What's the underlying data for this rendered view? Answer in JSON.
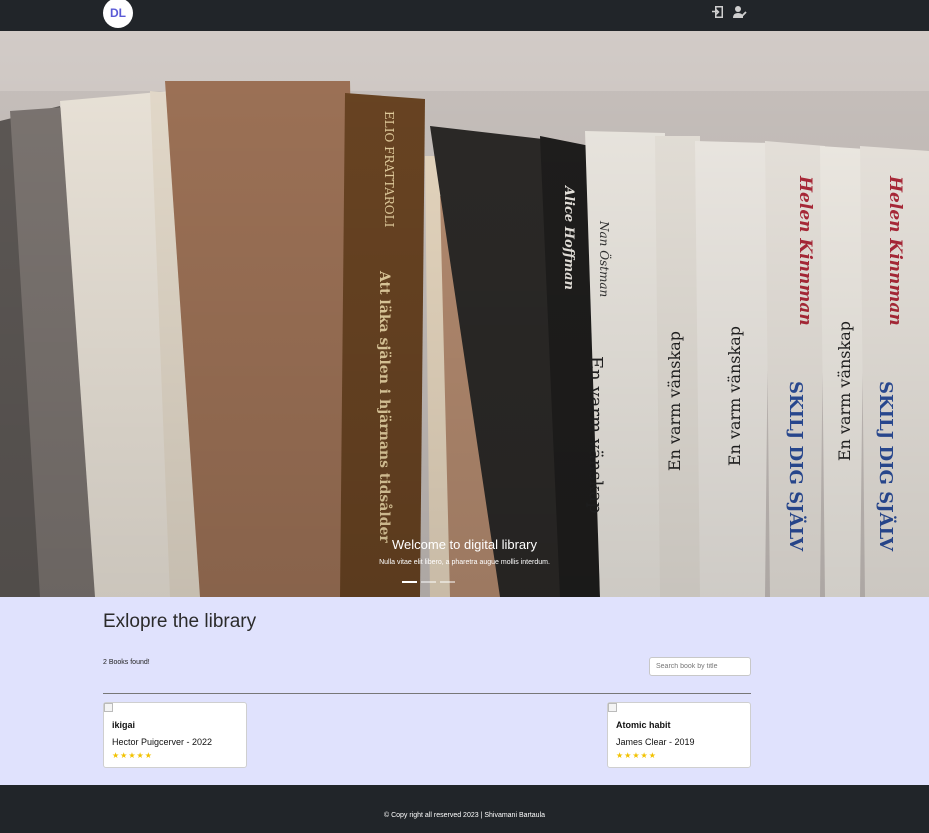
{
  "navbar": {
    "logo_text": "DL",
    "icons": [
      "login-icon",
      "register-user-icon"
    ]
  },
  "hero": {
    "caption_title": "Welcome to digital library",
    "caption_text": "Nulla vitae elit libero, a pharetra augue mollis interdum.",
    "spine_texts": [
      "ELIO FRATTAROLI",
      "Att läka själen i hjärnans tidsålder",
      "Alice Hoffman",
      "Nan Östman",
      "En varm vänskap",
      "Helen Kinnman",
      "SKILJ DIG SJÄLV"
    ],
    "slides_count": 3,
    "active_slide": 1
  },
  "explore": {
    "title": "Exlopre the library",
    "count_text": "2 Books found!",
    "search_placeholder": "Search book by title",
    "books": [
      {
        "title": "ikigai",
        "meta": "Hector Puigcerver - 2022",
        "stars": "★★★★★"
      },
      {
        "title": "Atomic habit",
        "meta": "James Clear - 2019",
        "stars": "★★★★★"
      }
    ]
  },
  "footer": {
    "text": "© Copy right all reserved 2023 | Shivamani Bartaula"
  },
  "colors": {
    "navbar_bg": "#212529",
    "explore_bg": "#e0e2fd",
    "star": "#f2c200",
    "logo_text": "#5b5bd6"
  }
}
